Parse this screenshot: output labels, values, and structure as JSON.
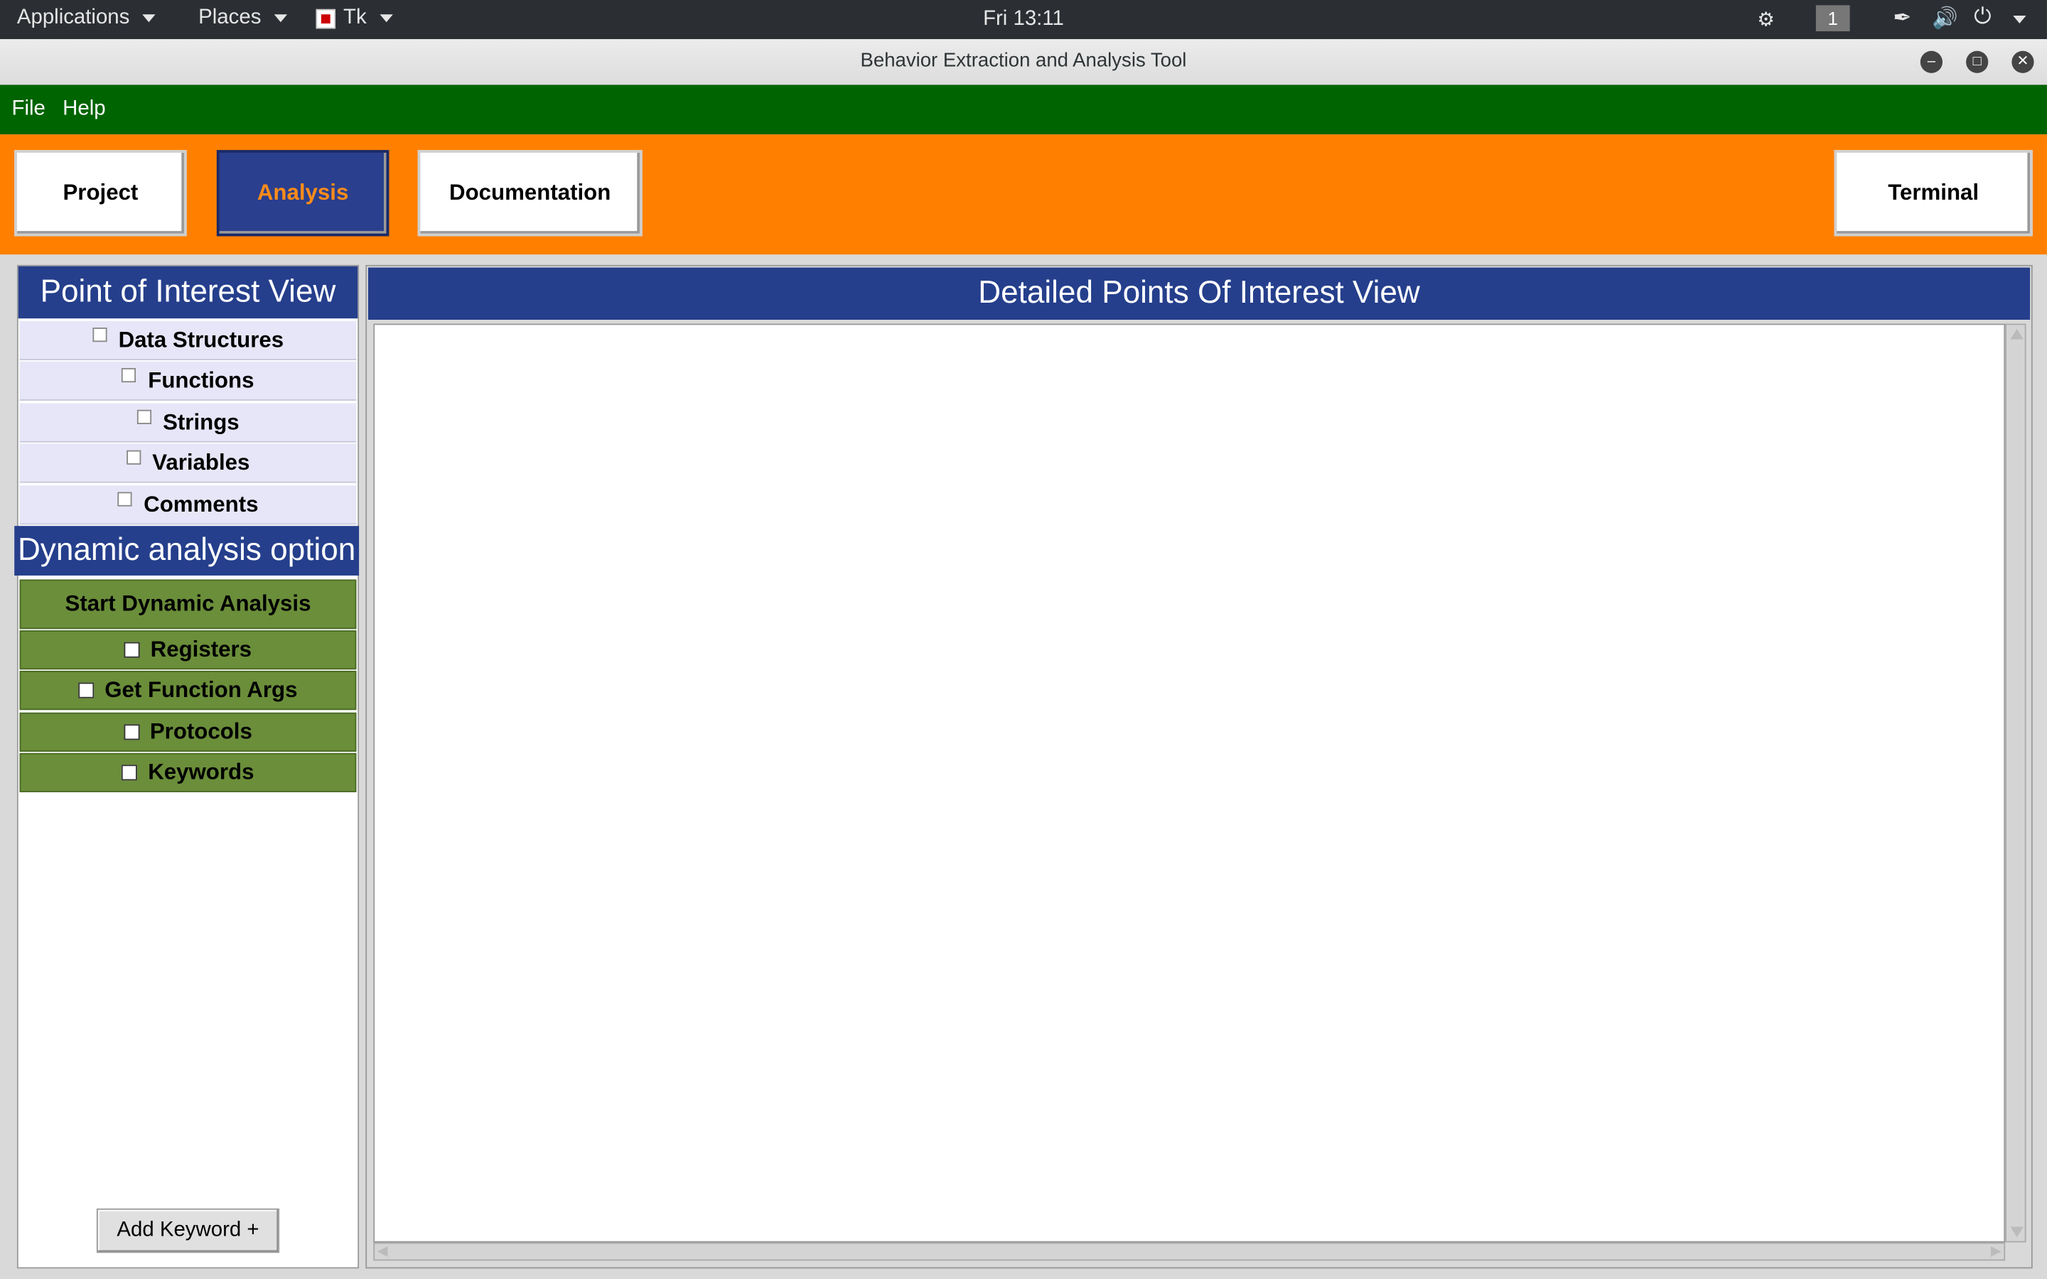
{
  "system_bar": {
    "applications": "Applications",
    "places": "Places",
    "tk": "Tk",
    "clock": "Fri 13:11",
    "workspace": "1"
  },
  "window": {
    "title": "Behavior Extraction and Analysis Tool"
  },
  "menubar": {
    "items": [
      "File",
      "Help"
    ]
  },
  "toolbar": {
    "project": "Project",
    "analysis": "Analysis",
    "documentation": "Documentation",
    "terminal": "Terminal",
    "active": "Analysis"
  },
  "left_panel": {
    "poi_header": "Point of Interest View",
    "poi_items": [
      "Data Structures",
      "Functions",
      "Strings",
      "Variables",
      "Comments"
    ],
    "dynamic_header": "Dynamic analysis option",
    "start_button": "Start Dynamic Analysis",
    "dynamic_items": [
      "Registers",
      "Get Function Args",
      "Protocols",
      "Keywords"
    ],
    "add_keyword": "Add Keyword +"
  },
  "right_panel": {
    "header": "Detailed Points Of Interest View"
  },
  "colors": {
    "menubar": "#006400",
    "toolbar": "#ff8000",
    "header_blue": "#253f8c",
    "dynamic_green": "#6b8e3a",
    "poi_row": "#e6e6f8"
  }
}
